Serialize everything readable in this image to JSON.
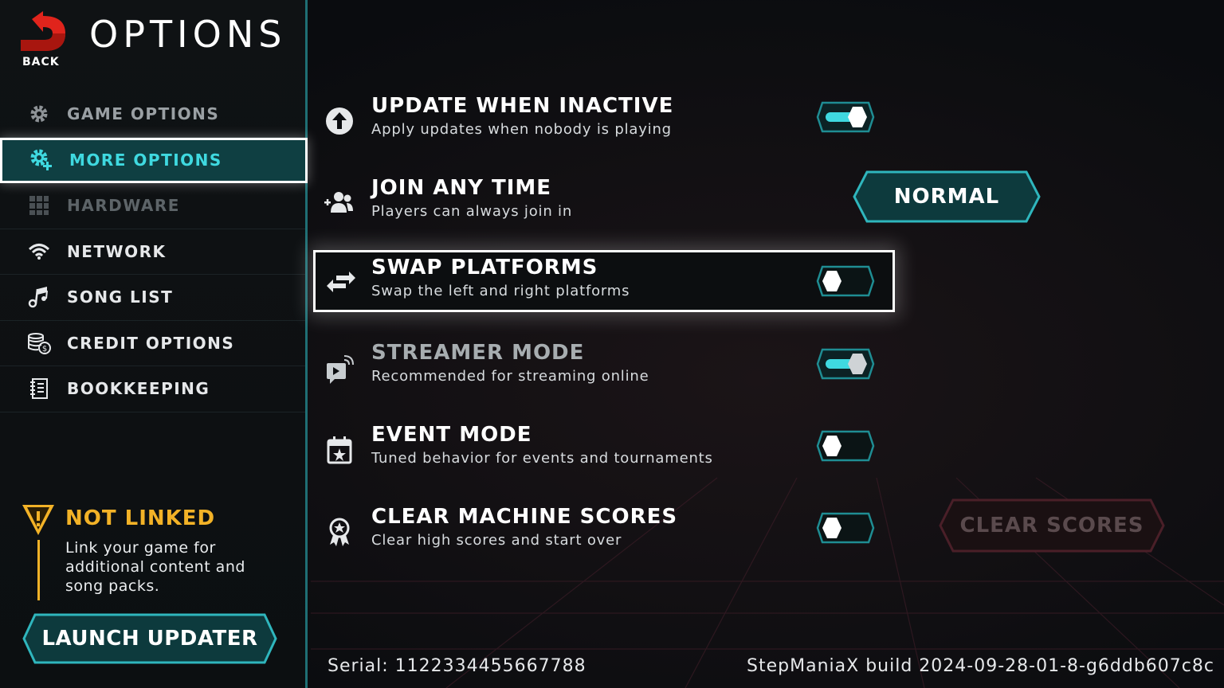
{
  "header": {
    "back_label": "BACK",
    "title": "OPTIONS"
  },
  "sidebar": {
    "items": [
      {
        "label": "GAME OPTIONS",
        "icon": "gear-icon"
      },
      {
        "label": "MORE OPTIONS",
        "icon": "gear-plus-icon",
        "selected": true
      },
      {
        "label": "HARDWARE",
        "icon": "grid-icon"
      },
      {
        "label": "NETWORK",
        "icon": "wifi-icon"
      },
      {
        "label": "SONG LIST",
        "icon": "music-notes-icon"
      },
      {
        "label": "CREDIT OPTIONS",
        "icon": "coins-icon"
      },
      {
        "label": "BOOKKEEPING",
        "icon": "ledger-icon"
      }
    ]
  },
  "notice": {
    "title": "NOT LINKED",
    "text": "Link your game for additional content and song packs.",
    "icon": "warning-icon"
  },
  "launch_button": "LAUNCH UPDATER",
  "settings": [
    {
      "title": "UPDATE WHEN INACTIVE",
      "subtitle": "Apply updates when nobody is playing",
      "icon": "upload-arrow-icon",
      "toggle_on": true
    },
    {
      "title": "JOIN ANY TIME",
      "subtitle": "Players can always join in",
      "icon": "add-users-icon",
      "value": "NORMAL"
    },
    {
      "title": "SWAP PLATFORMS",
      "subtitle": "Swap the left and right platforms",
      "icon": "swap-arrows-icon",
      "toggle_on": false,
      "focused": true
    },
    {
      "title": "STREAMER MODE",
      "subtitle": "Recommended for streaming online",
      "icon": "broadcast-icon",
      "toggle_on": true
    },
    {
      "title": "EVENT MODE",
      "subtitle": "Tuned behavior for events and tournaments",
      "icon": "calendar-star-icon",
      "toggle_on": false
    },
    {
      "title": "CLEAR MACHINE SCORES",
      "subtitle": "Clear high scores and start over",
      "icon": "award-icon",
      "toggle_on": false
    }
  ],
  "clear_button": "CLEAR SCORES",
  "footer": {
    "serial": "Serial: 1122334455667788",
    "build": "StepManiaX build 2024-09-28-01-8-g6ddb607c8c"
  },
  "colors": {
    "accent": "#3fd9e0",
    "teal_dark": "#0f3f42",
    "warning": "#f2b227",
    "toggle_on": "#3fd9e0"
  }
}
